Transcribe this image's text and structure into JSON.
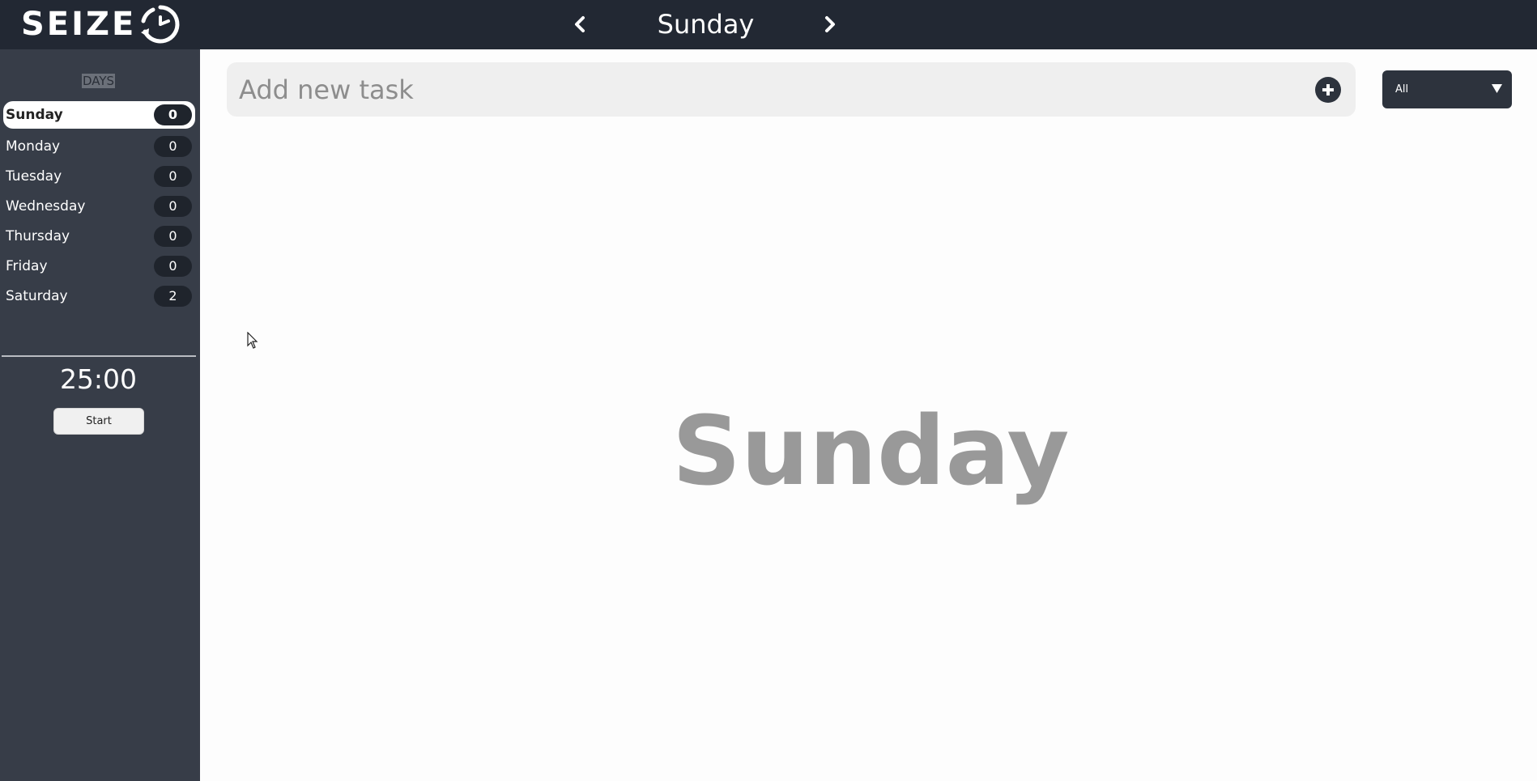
{
  "app": {
    "logo_text": "SEIZE",
    "logo_icon": "clock-icon"
  },
  "header": {
    "title": "Sunday",
    "prev_icon": "chevron-left-icon",
    "next_icon": "chevron-right-icon"
  },
  "sidebar": {
    "heading": "DAYS",
    "days": [
      {
        "label": "Sunday",
        "count": "0",
        "active": true
      },
      {
        "label": "Monday",
        "count": "0",
        "active": false
      },
      {
        "label": "Tuesday",
        "count": "0",
        "active": false
      },
      {
        "label": "Wednesday",
        "count": "0",
        "active": false
      },
      {
        "label": "Thursday",
        "count": "0",
        "active": false
      },
      {
        "label": "Friday",
        "count": "0",
        "active": false
      },
      {
        "label": "Saturday",
        "count": "2",
        "active": false
      }
    ],
    "timer": "25:00",
    "start_label": "Start"
  },
  "main": {
    "task_input": {
      "placeholder": "Add new task",
      "value": "",
      "add_icon": "plus-circle-icon"
    },
    "filter": {
      "selected": "All",
      "caret_icon": "caret-down-icon"
    },
    "big_day": "Sunday"
  },
  "colors": {
    "topbar": "#222833",
    "sidebar": "#373d48",
    "badge": "#1f242c",
    "big_text": "#999999"
  }
}
